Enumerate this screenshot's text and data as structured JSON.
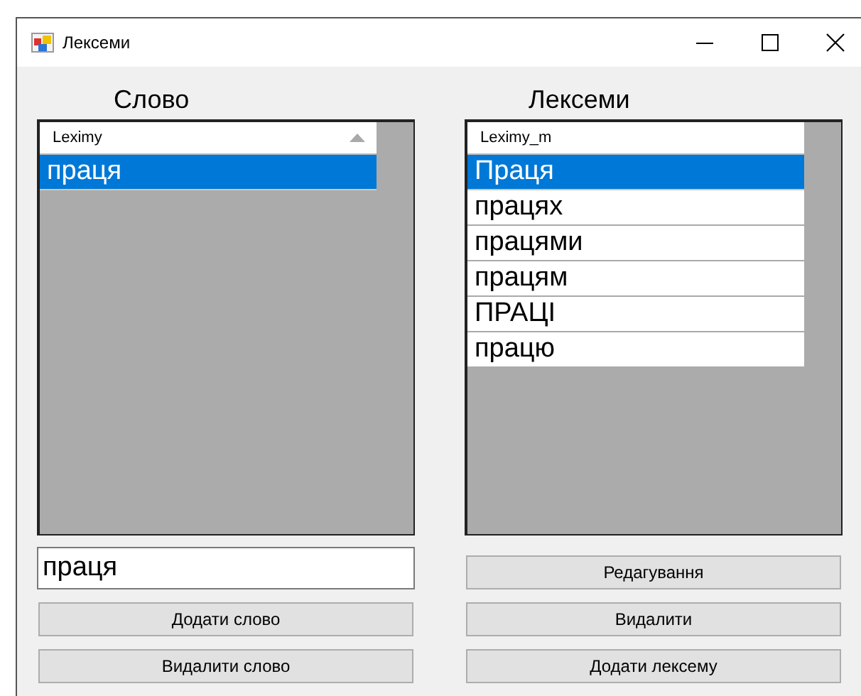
{
  "window": {
    "title": "Лексеми"
  },
  "left": {
    "heading": "Слово",
    "grid": {
      "column": "Leximy",
      "sorted_ascending": true,
      "rows": [
        {
          "text": "праця",
          "selected": true
        }
      ]
    },
    "input": {
      "value": "праця"
    },
    "buttons": [
      "Додати слово",
      "Видалити слово"
    ]
  },
  "right": {
    "heading": "Лексеми",
    "grid": {
      "column": "Leximy_m",
      "rows": [
        {
          "text": "Праця",
          "selected": true
        },
        {
          "text": "працях",
          "selected": false
        },
        {
          "text": "працями",
          "selected": false
        },
        {
          "text": "працям",
          "selected": false
        },
        {
          "text": "ПРАЦІ",
          "selected": false
        },
        {
          "text": "працю",
          "selected": false
        }
      ]
    },
    "buttons": [
      "Редагування",
      "Видалити",
      "Додати лексему"
    ]
  }
}
